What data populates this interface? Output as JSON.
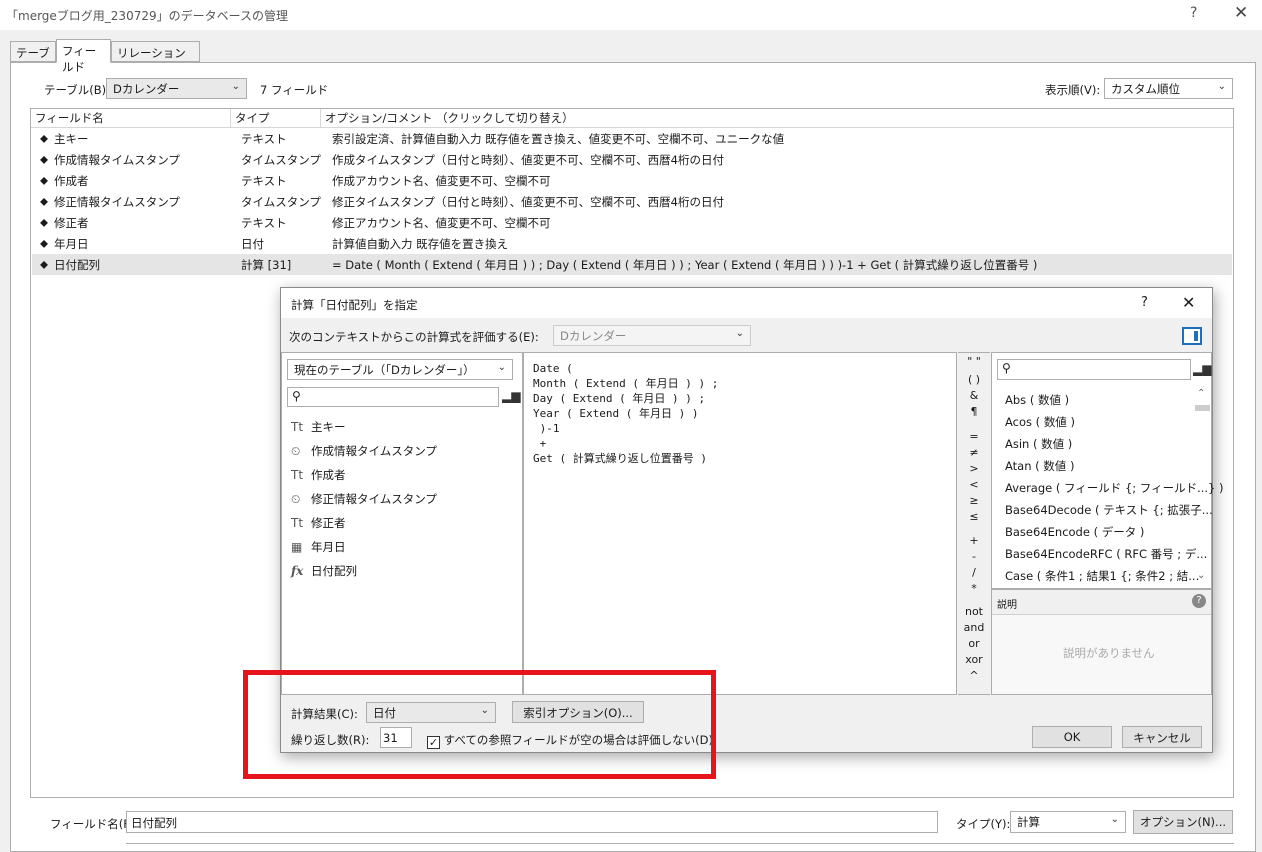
{
  "window": {
    "title": "「mergeブログ用_230729」のデータベースの管理",
    "help_icon": "?",
    "close_icon": "✕"
  },
  "tabs": [
    {
      "label": "テーブル"
    },
    {
      "label": "フィールド"
    },
    {
      "label": "リレーションシップ"
    }
  ],
  "toolbar": {
    "table_label": "テーブル(B):",
    "table_value": "Dカレンダー",
    "field_count": "7 フィールド",
    "order_label": "表示順(V):",
    "order_value": "カスタム順位"
  },
  "columns": [
    "フィールド名",
    "タイプ",
    "オプション/コメント （クリックして切り替え）"
  ],
  "fields": [
    {
      "name": "主キー",
      "type": "テキスト",
      "options": "索引設定済、計算値自動入力 既存値を置き換え、値変更不可、空欄不可、ユニークな値"
    },
    {
      "name": "作成情報タイムスタンプ",
      "type": "タイムスタンプ",
      "options": "作成タイムスタンプ（日付と時刻）、値変更不可、空欄不可、西暦4桁の日付"
    },
    {
      "name": "作成者",
      "type": "テキスト",
      "options": "作成アカウント名、値変更不可、空欄不可"
    },
    {
      "name": "修正情報タイムスタンプ",
      "type": "タイムスタンプ",
      "options": "修正タイムスタンプ（日付と時刻）、値変更不可、空欄不可、西暦4桁の日付"
    },
    {
      "name": "修正者",
      "type": "テキスト",
      "options": "修正アカウント名、値変更不可、空欄不可"
    },
    {
      "name": "年月日",
      "type": "日付",
      "options": "計算値自動入力 既存値を置き換え"
    },
    {
      "name": "日付配列",
      "type": "計算 [31]",
      "options": "= Date ( Month ( Extend ( 年月日 ) ) ; Day ( Extend ( 年月日 ) ) ; Year ( Extend ( 年月日 ) ) )-1 + Get ( 計算式繰り返し位置番号 )"
    }
  ],
  "bottom": {
    "field_name_label": "フィールド名(F):",
    "field_name_value": "日付配列",
    "type_label": "タイプ(Y):",
    "type_value": "計算",
    "options_button": "オプション(N)..."
  },
  "dialog": {
    "title": "計算「日付配列」を指定",
    "help_icon": "?",
    "close_icon": "✕",
    "context_label": "次のコンテキストからこの計算式を評価する(E):",
    "context_value": "Dカレンダー",
    "table_select": "現在のテーブル（「Dカレンダー」）",
    "field_list": [
      {
        "icon": "Tt",
        "name": "主キー"
      },
      {
        "icon": "⏲",
        "name": "作成情報タイムスタンプ"
      },
      {
        "icon": "Tt",
        "name": "作成者"
      },
      {
        "icon": "⏲",
        "name": "修正情報タイムスタンプ"
      },
      {
        "icon": "Tt",
        "name": "修正者"
      },
      {
        "icon": "▦",
        "name": "年月日"
      },
      {
        "icon": "fx",
        "name": "日付配列"
      }
    ],
    "formula": "Date (\nMonth ( Extend ( 年月日 ) ) ;\nDay ( Extend ( 年月日 ) ) ;\nYear ( Extend ( 年月日 ) )\n )-1\n +\nGet ( 計算式繰り返し位置番号 )",
    "operators": [
      "\" \"",
      "( )",
      "&",
      "¶",
      "=",
      "≠",
      ">",
      "<",
      "≥",
      "≤",
      "+",
      "-",
      "/",
      "*",
      "not",
      "and",
      "or",
      "xor",
      "^"
    ],
    "functions": [
      "Abs ( 数値 )",
      "Acos ( 数値 )",
      "Asin ( 数値 )",
      "Atan ( 数値 )",
      "Average ( フィールド {; フィールド...} )",
      "Base64Decode ( テキスト {; 拡張子...",
      "Base64Encode ( データ )",
      "Base64EncodeRFC ( RFC 番号 ; デ...",
      "Case ( 条件1 ; 結果1 {; 条件2 ; 結..."
    ],
    "desc_label": "説明",
    "desc_empty": "説明がありません",
    "result_label": "計算結果(C):",
    "result_value": "日付",
    "index_button": "索引オプション(O)...",
    "repeat_label": "繰り返し数(R):",
    "repeat_value": "31",
    "noeval_label": "すべての参照フィールドが空の場合は評価しない(D)",
    "noeval_checked": "✓",
    "ok": "OK",
    "cancel": "キャンセル"
  },
  "accent": {
    "highlight": "#e8141c"
  }
}
